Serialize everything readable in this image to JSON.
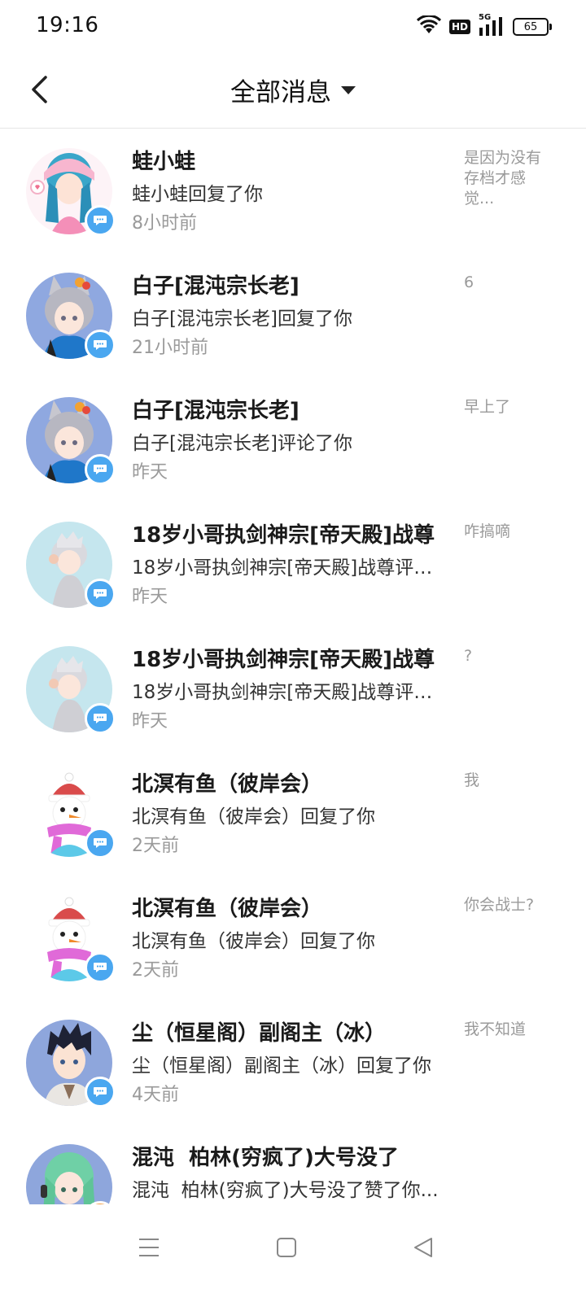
{
  "status_bar": {
    "time": "19:16",
    "network": "5G",
    "hd": "HD",
    "battery": "65"
  },
  "header": {
    "title": "全部消息"
  },
  "messages": [
    {
      "name": "蛙小蛙",
      "preview": "蛙小蛙回复了你",
      "time": "8小时前",
      "quote": "是因为没有存档才感觉...",
      "avatar": "pink-girl",
      "badge": "blue"
    },
    {
      "name": "白子[混沌宗长老]",
      "preview": "白子[混沌宗长老]回复了你",
      "time": "21小时前",
      "quote": "6",
      "avatar": "gray-fox",
      "badge": "blue"
    },
    {
      "name": "白子[混沌宗长老]",
      "preview": "白子[混沌宗长老]评论了你",
      "time": "昨天",
      "quote": "早上了",
      "avatar": "gray-fox",
      "badge": "blue"
    },
    {
      "name": "18岁小哥执剑神宗[帝天殿]战尊",
      "preview": "18岁小哥执剑神宗[帝天殿]战尊评论了你",
      "time": "昨天",
      "quote": "咋搞嘀",
      "avatar": "silver-boy",
      "badge": "blue"
    },
    {
      "name": "18岁小哥执剑神宗[帝天殿]战尊",
      "preview": "18岁小哥执剑神宗[帝天殿]战尊评论了你",
      "time": "昨天",
      "quote": "?",
      "avatar": "silver-boy",
      "badge": "blue"
    },
    {
      "name": "北溟有鱼（彼岸会）",
      "preview": "北溟有鱼（彼岸会）回复了你",
      "time": "2天前",
      "quote": "我",
      "avatar": "snowman",
      "badge": "blue"
    },
    {
      "name": "北溟有鱼（彼岸会）",
      "preview": "北溟有鱼（彼岸会）回复了你",
      "time": "2天前",
      "quote": "你会战士?",
      "avatar": "snowman",
      "badge": "blue"
    },
    {
      "name": "尘（恒星阁）副阁主（冰）",
      "preview": "尘（恒星阁）副阁主（冰）回复了你",
      "time": "4天前",
      "quote": "我不知道",
      "avatar": "dark-boy",
      "badge": "blue"
    },
    {
      "name": "混沌  柏林(穷疯了)大号没了",
      "preview": "混沌  柏林(穷疯了)大号没了赞了你...",
      "time": "",
      "quote": "",
      "avatar": "green-girl",
      "badge": "orange"
    }
  ],
  "colors": {
    "badge_blue": "#4aa7f0",
    "badge_orange": "#f39a3c",
    "secondary_text": "#9a9a9a"
  },
  "icons": {
    "back": "back-arrow-icon",
    "dropdown": "caret-down-icon",
    "badge": "chat-bubble-icon",
    "nav_menu": "menu-icon",
    "nav_home": "home-square-icon",
    "nav_back": "back-triangle-icon"
  }
}
